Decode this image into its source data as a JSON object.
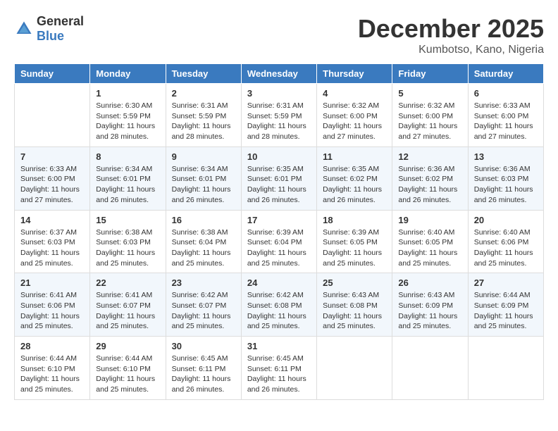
{
  "header": {
    "logo_general": "General",
    "logo_blue": "Blue",
    "month_title": "December 2025",
    "location": "Kumbotso, Kano, Nigeria"
  },
  "days_of_week": [
    "Sunday",
    "Monday",
    "Tuesday",
    "Wednesday",
    "Thursday",
    "Friday",
    "Saturday"
  ],
  "weeks": [
    [
      {
        "day": "",
        "sunrise": "",
        "sunset": "",
        "daylight": ""
      },
      {
        "day": "1",
        "sunrise": "Sunrise: 6:30 AM",
        "sunset": "Sunset: 5:59 PM",
        "daylight": "Daylight: 11 hours and 28 minutes."
      },
      {
        "day": "2",
        "sunrise": "Sunrise: 6:31 AM",
        "sunset": "Sunset: 5:59 PM",
        "daylight": "Daylight: 11 hours and 28 minutes."
      },
      {
        "day": "3",
        "sunrise": "Sunrise: 6:31 AM",
        "sunset": "Sunset: 5:59 PM",
        "daylight": "Daylight: 11 hours and 28 minutes."
      },
      {
        "day": "4",
        "sunrise": "Sunrise: 6:32 AM",
        "sunset": "Sunset: 6:00 PM",
        "daylight": "Daylight: 11 hours and 27 minutes."
      },
      {
        "day": "5",
        "sunrise": "Sunrise: 6:32 AM",
        "sunset": "Sunset: 6:00 PM",
        "daylight": "Daylight: 11 hours and 27 minutes."
      },
      {
        "day": "6",
        "sunrise": "Sunrise: 6:33 AM",
        "sunset": "Sunset: 6:00 PM",
        "daylight": "Daylight: 11 hours and 27 minutes."
      }
    ],
    [
      {
        "day": "7",
        "sunrise": "Sunrise: 6:33 AM",
        "sunset": "Sunset: 6:00 PM",
        "daylight": "Daylight: 11 hours and 27 minutes."
      },
      {
        "day": "8",
        "sunrise": "Sunrise: 6:34 AM",
        "sunset": "Sunset: 6:01 PM",
        "daylight": "Daylight: 11 hours and 26 minutes."
      },
      {
        "day": "9",
        "sunrise": "Sunrise: 6:34 AM",
        "sunset": "Sunset: 6:01 PM",
        "daylight": "Daylight: 11 hours and 26 minutes."
      },
      {
        "day": "10",
        "sunrise": "Sunrise: 6:35 AM",
        "sunset": "Sunset: 6:01 PM",
        "daylight": "Daylight: 11 hours and 26 minutes."
      },
      {
        "day": "11",
        "sunrise": "Sunrise: 6:35 AM",
        "sunset": "Sunset: 6:02 PM",
        "daylight": "Daylight: 11 hours and 26 minutes."
      },
      {
        "day": "12",
        "sunrise": "Sunrise: 6:36 AM",
        "sunset": "Sunset: 6:02 PM",
        "daylight": "Daylight: 11 hours and 26 minutes."
      },
      {
        "day": "13",
        "sunrise": "Sunrise: 6:36 AM",
        "sunset": "Sunset: 6:03 PM",
        "daylight": "Daylight: 11 hours and 26 minutes."
      }
    ],
    [
      {
        "day": "14",
        "sunrise": "Sunrise: 6:37 AM",
        "sunset": "Sunset: 6:03 PM",
        "daylight": "Daylight: 11 hours and 25 minutes."
      },
      {
        "day": "15",
        "sunrise": "Sunrise: 6:38 AM",
        "sunset": "Sunset: 6:03 PM",
        "daylight": "Daylight: 11 hours and 25 minutes."
      },
      {
        "day": "16",
        "sunrise": "Sunrise: 6:38 AM",
        "sunset": "Sunset: 6:04 PM",
        "daylight": "Daylight: 11 hours and 25 minutes."
      },
      {
        "day": "17",
        "sunrise": "Sunrise: 6:39 AM",
        "sunset": "Sunset: 6:04 PM",
        "daylight": "Daylight: 11 hours and 25 minutes."
      },
      {
        "day": "18",
        "sunrise": "Sunrise: 6:39 AM",
        "sunset": "Sunset: 6:05 PM",
        "daylight": "Daylight: 11 hours and 25 minutes."
      },
      {
        "day": "19",
        "sunrise": "Sunrise: 6:40 AM",
        "sunset": "Sunset: 6:05 PM",
        "daylight": "Daylight: 11 hours and 25 minutes."
      },
      {
        "day": "20",
        "sunrise": "Sunrise: 6:40 AM",
        "sunset": "Sunset: 6:06 PM",
        "daylight": "Daylight: 11 hours and 25 minutes."
      }
    ],
    [
      {
        "day": "21",
        "sunrise": "Sunrise: 6:41 AM",
        "sunset": "Sunset: 6:06 PM",
        "daylight": "Daylight: 11 hours and 25 minutes."
      },
      {
        "day": "22",
        "sunrise": "Sunrise: 6:41 AM",
        "sunset": "Sunset: 6:07 PM",
        "daylight": "Daylight: 11 hours and 25 minutes."
      },
      {
        "day": "23",
        "sunrise": "Sunrise: 6:42 AM",
        "sunset": "Sunset: 6:07 PM",
        "daylight": "Daylight: 11 hours and 25 minutes."
      },
      {
        "day": "24",
        "sunrise": "Sunrise: 6:42 AM",
        "sunset": "Sunset: 6:08 PM",
        "daylight": "Daylight: 11 hours and 25 minutes."
      },
      {
        "day": "25",
        "sunrise": "Sunrise: 6:43 AM",
        "sunset": "Sunset: 6:08 PM",
        "daylight": "Daylight: 11 hours and 25 minutes."
      },
      {
        "day": "26",
        "sunrise": "Sunrise: 6:43 AM",
        "sunset": "Sunset: 6:09 PM",
        "daylight": "Daylight: 11 hours and 25 minutes."
      },
      {
        "day": "27",
        "sunrise": "Sunrise: 6:44 AM",
        "sunset": "Sunset: 6:09 PM",
        "daylight": "Daylight: 11 hours and 25 minutes."
      }
    ],
    [
      {
        "day": "28",
        "sunrise": "Sunrise: 6:44 AM",
        "sunset": "Sunset: 6:10 PM",
        "daylight": "Daylight: 11 hours and 25 minutes."
      },
      {
        "day": "29",
        "sunrise": "Sunrise: 6:44 AM",
        "sunset": "Sunset: 6:10 PM",
        "daylight": "Daylight: 11 hours and 25 minutes."
      },
      {
        "day": "30",
        "sunrise": "Sunrise: 6:45 AM",
        "sunset": "Sunset: 6:11 PM",
        "daylight": "Daylight: 11 hours and 26 minutes."
      },
      {
        "day": "31",
        "sunrise": "Sunrise: 6:45 AM",
        "sunset": "Sunset: 6:11 PM",
        "daylight": "Daylight: 11 hours and 26 minutes."
      },
      {
        "day": "",
        "sunrise": "",
        "sunset": "",
        "daylight": ""
      },
      {
        "day": "",
        "sunrise": "",
        "sunset": "",
        "daylight": ""
      },
      {
        "day": "",
        "sunrise": "",
        "sunset": "",
        "daylight": ""
      }
    ]
  ]
}
